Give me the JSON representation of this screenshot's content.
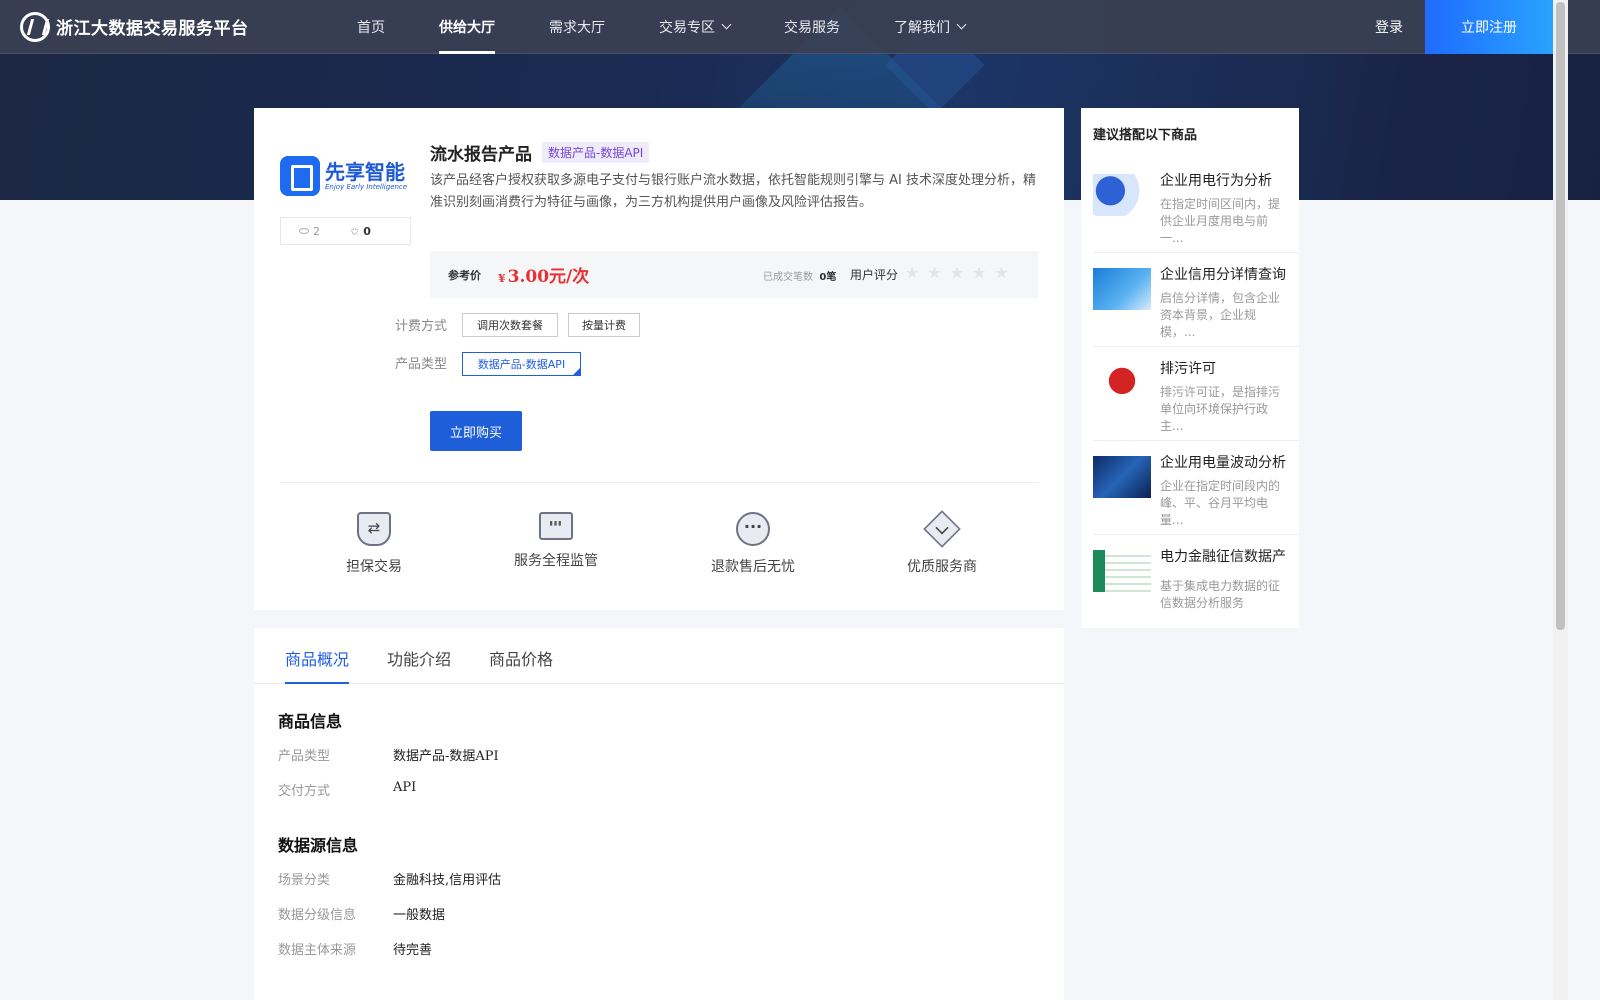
{
  "nav": {
    "brand": "浙江大数据交易服务平台",
    "items": [
      {
        "label": "首页",
        "active": false,
        "dropdown": false
      },
      {
        "label": "供给大厅",
        "active": true,
        "dropdown": false
      },
      {
        "label": "需求大厅",
        "active": false,
        "dropdown": false
      },
      {
        "label": "交易专区",
        "active": false,
        "dropdown": true
      },
      {
        "label": "交易服务",
        "active": false,
        "dropdown": false
      },
      {
        "label": "了解我们",
        "active": false,
        "dropdown": true
      }
    ],
    "login": "登录",
    "register": "立即注册"
  },
  "product": {
    "logo_title": "先享智能",
    "logo_subtitle": "Enjoy Early Intelligence",
    "views": "2",
    "favorites": "0",
    "title": "流水报告产品",
    "tag": "数据产品-数据API",
    "description": "该产品经客户授权获取多源电子支付与银行账户流水数据，依托智能规则引擎与 AI 技术深度处理分析，精准识别刻画消费行为特征与画像，为三方机构提供用户画像及风险评估报告。",
    "price_label": "参考价",
    "price_currency": "¥",
    "price_value": "3.00元/次",
    "deals_label": "已成交笔数",
    "deals_value": "0笔",
    "rating_label": "用户评分",
    "rating": 0,
    "billing_label": "计费方式",
    "billing_options": [
      "调用次数套餐",
      "按量计费"
    ],
    "type_label": "产品类型",
    "type_options": [
      "数据产品-数据API"
    ],
    "buy_label": "立即购买",
    "features": [
      {
        "label": "担保交易",
        "icon": "shield-icon"
      },
      {
        "label": "服务全程监管",
        "icon": "monitor-icon"
      },
      {
        "label": "退款售后无忧",
        "icon": "chat-icon"
      },
      {
        "label": "优质服务商",
        "icon": "diamond-icon"
      }
    ]
  },
  "sidebar": {
    "title": "建议搭配以下商品",
    "items": [
      {
        "name": "企业用电行为分析",
        "desc": "在指定时间区间内，提供企业月度用电与前一..."
      },
      {
        "name": "企业信用分详情查询",
        "desc": "启信分详情，包含企业资本背景，企业规模，..."
      },
      {
        "name": "排污许可",
        "desc": "排污许可证，是指排污单位向环境保护行政主..."
      },
      {
        "name": "企业用电量波动分析",
        "desc": "企业在指定时间段内的峰、平、谷月平均电量..."
      },
      {
        "name": "电力金融征信数据产",
        "desc": "基于集成电力数据的征信数据分析服务"
      }
    ]
  },
  "tabs": {
    "items": [
      "商品概况",
      "功能介绍",
      "商品价格"
    ],
    "active": 0
  },
  "details": {
    "info_title": "商品信息",
    "info_rows": [
      {
        "label": "产品类型",
        "value": "数据产品-数据API"
      },
      {
        "label": "交付方式",
        "value": "API"
      }
    ],
    "source_title": "数据源信息",
    "source_rows": [
      {
        "label": "场景分类",
        "value": "金融科技,信用评估"
      },
      {
        "label": "数据分级信息",
        "value": "一般数据"
      },
      {
        "label": "数据主体来源",
        "value": "待完善"
      }
    ]
  }
}
